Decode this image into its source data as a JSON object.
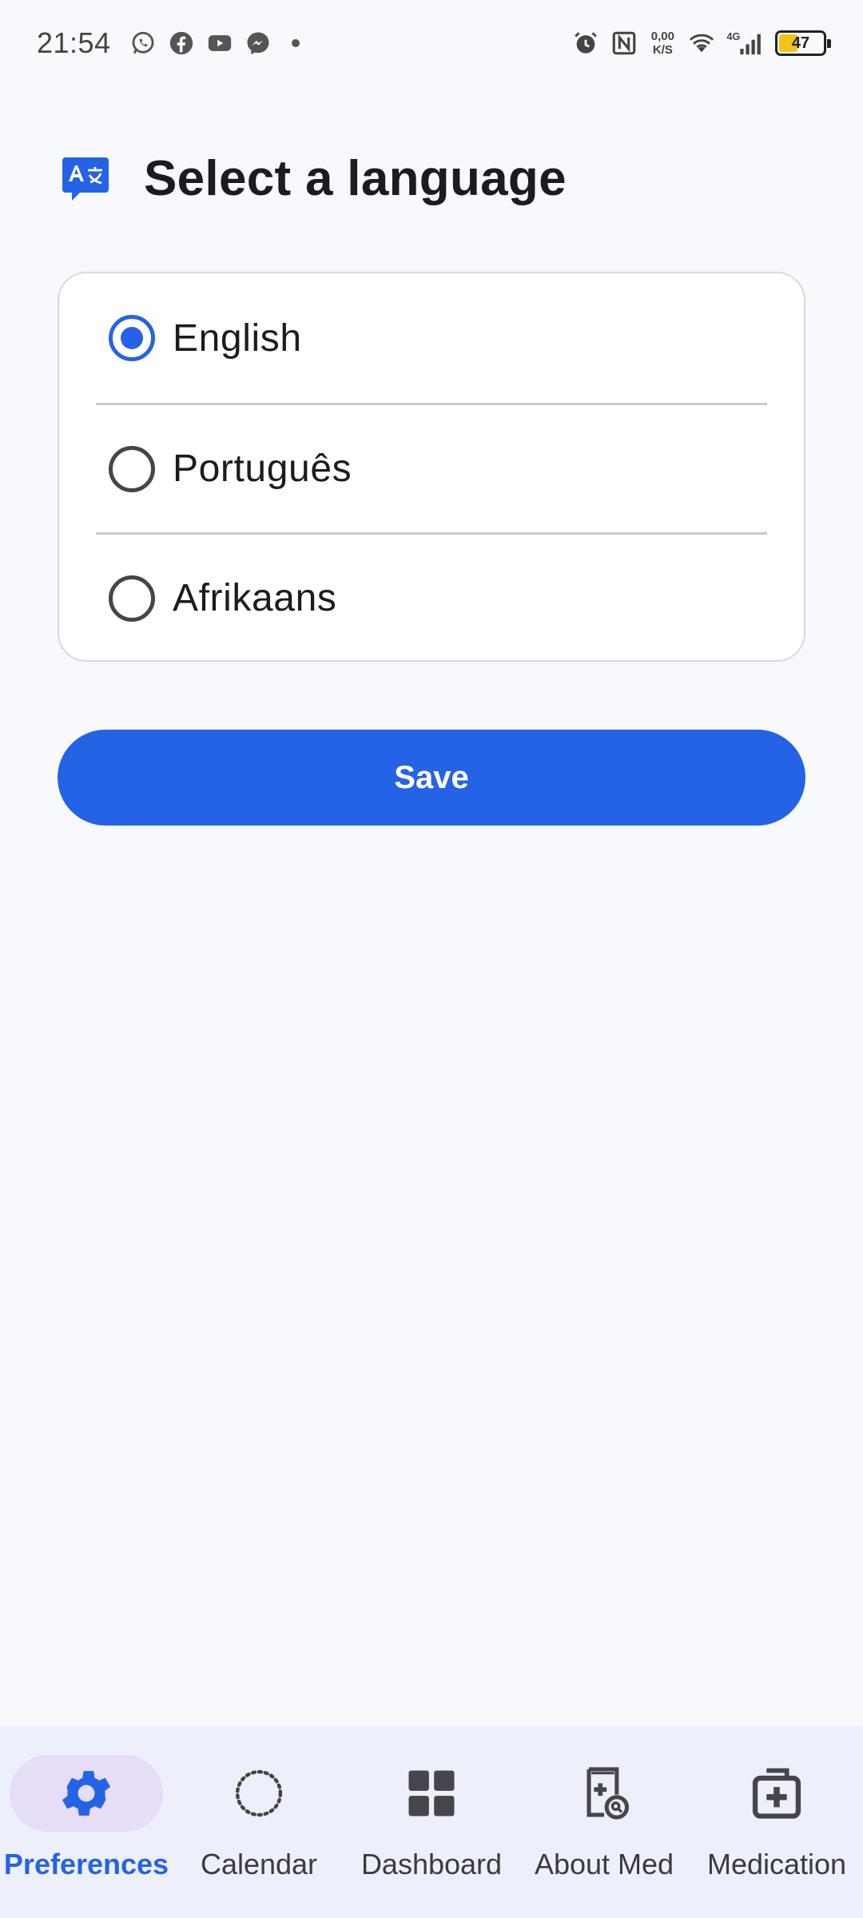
{
  "status_bar": {
    "time": "21:54",
    "notification_icons": [
      "whatsapp-icon",
      "facebook-icon",
      "youtube-icon",
      "messenger-icon"
    ],
    "net_speed_value": "0,00",
    "net_speed_unit": "K/S",
    "network": "4G",
    "battery_level": "47",
    "battery_fraction": 0.47,
    "battery_color": "#f5c21b"
  },
  "header": {
    "title": "Select a language",
    "icon": "translate-icon"
  },
  "languages": {
    "options": [
      {
        "label": "English",
        "selected": true
      },
      {
        "label": "Português",
        "selected": false
      },
      {
        "label": "Afrikaans",
        "selected": false
      }
    ]
  },
  "actions": {
    "save_label": "Save"
  },
  "bottom_nav": {
    "items": [
      {
        "label": "Preferences",
        "icon": "gear-icon",
        "active": true
      },
      {
        "label": "Calendar",
        "icon": "dotted-circle-icon",
        "active": false
      },
      {
        "label": "Dashboard",
        "icon": "dashboard-grid-icon",
        "active": false
      },
      {
        "label": "About Med",
        "icon": "medical-book-search-icon",
        "active": false
      },
      {
        "label": "Medication",
        "icon": "medicine-box-icon",
        "active": false
      }
    ]
  },
  "colors": {
    "accent": "#2563e6",
    "background": "#f7f9fc",
    "nav_background": "#edf0fa",
    "active_pill": "#e6ddf6"
  }
}
